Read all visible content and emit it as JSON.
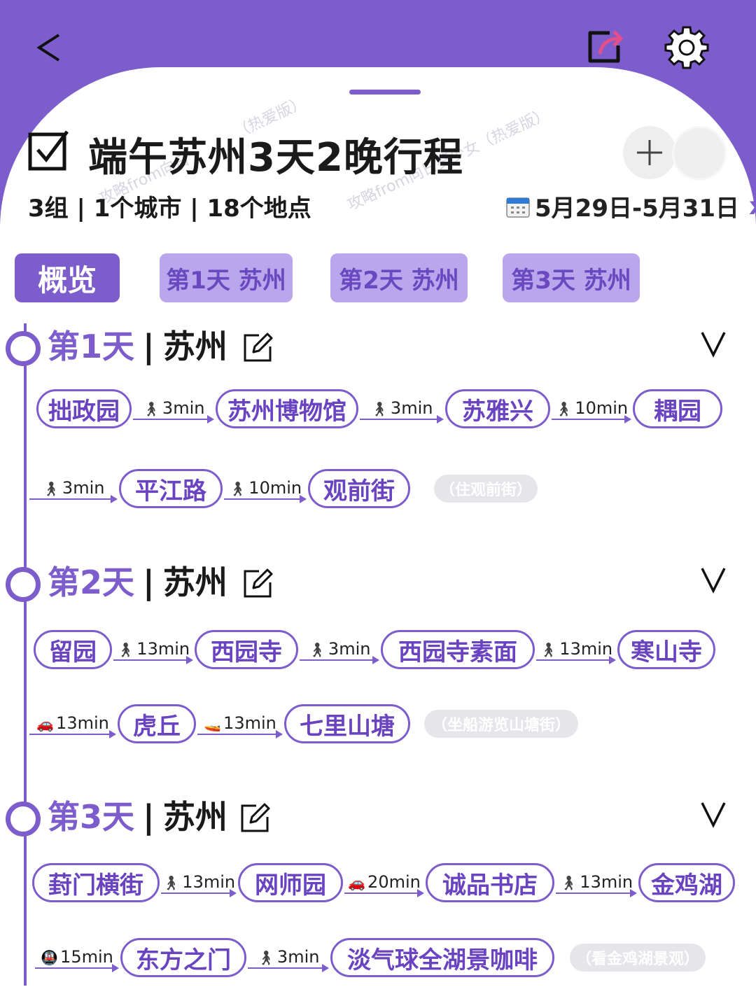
{
  "header": {
    "title": "端午苏州3天2晚行程",
    "stats": "3组 | 1个城市 | 18个地点",
    "date_range": "5月29日-5月31日",
    "date_close": "x",
    "watermark_1": "（热爱版）",
    "watermark_2": "攻略from向日",
    "watermark_3": "攻略from向日葵少女（热爱版）"
  },
  "tabs": [
    "概览",
    "第1天 苏州",
    "第2天 苏州",
    "第3天 苏州"
  ],
  "days": [
    {
      "label": "第1天",
      "sep": "|",
      "city": "苏州",
      "stops": [
        "拙政园",
        "苏州博物馆",
        "苏雅兴",
        "耦园",
        "平江路",
        "观前街"
      ],
      "legs": [
        {
          "mode": "walk",
          "time": "3min"
        },
        {
          "mode": "walk",
          "time": "3min"
        },
        {
          "mode": "walk",
          "time": "10min"
        },
        {
          "mode": "walk",
          "time": "3min"
        },
        {
          "mode": "walk",
          "time": "10min"
        }
      ],
      "note": "（住观前街）"
    },
    {
      "label": "第2天",
      "sep": "|",
      "city": "苏州",
      "stops": [
        "留园",
        "西园寺",
        "西园寺素面",
        "寒山寺",
        "虎丘",
        "七里山塘"
      ],
      "legs": [
        {
          "mode": "walk",
          "time": "13min"
        },
        {
          "mode": "walk",
          "time": "3min"
        },
        {
          "mode": "walk",
          "time": "13min"
        },
        {
          "mode": "car",
          "time": "13min"
        },
        {
          "mode": "boat",
          "time": "13min"
        }
      ],
      "note": "（坐船游览山塘街）"
    },
    {
      "label": "第3天",
      "sep": "|",
      "city": "苏州",
      "stops": [
        "葑门横街",
        "网师园",
        "诚品书店",
        "金鸡湖",
        "东方之门",
        "淡气球全湖景咖啡"
      ],
      "legs": [
        {
          "mode": "walk",
          "time": "13min"
        },
        {
          "mode": "car",
          "time": "20min"
        },
        {
          "mode": "walk",
          "time": "13min"
        },
        {
          "mode": "metro",
          "time": "15min"
        },
        {
          "mode": "walk",
          "time": "3min"
        }
      ],
      "note": "（看金鸡湖景观）"
    }
  ],
  "icons": {
    "back": "back-chevron-icon",
    "share": "share-icon",
    "settings": "gear-icon",
    "checklist": "checkbox-icon",
    "add": "plus-icon",
    "calendar": "calendar-icon",
    "edit": "edit-icon",
    "expand": "chevron-down-icon",
    "walk": "walking-person-icon",
    "car": "car-icon",
    "boat": "boat-icon",
    "metro": "metro-icon"
  },
  "colors": {
    "accent": "#7d5ccb",
    "accent_text": "#6a44c0",
    "tab_inactive": "#b9a6ec",
    "note_bg": "#e6e6ea"
  }
}
